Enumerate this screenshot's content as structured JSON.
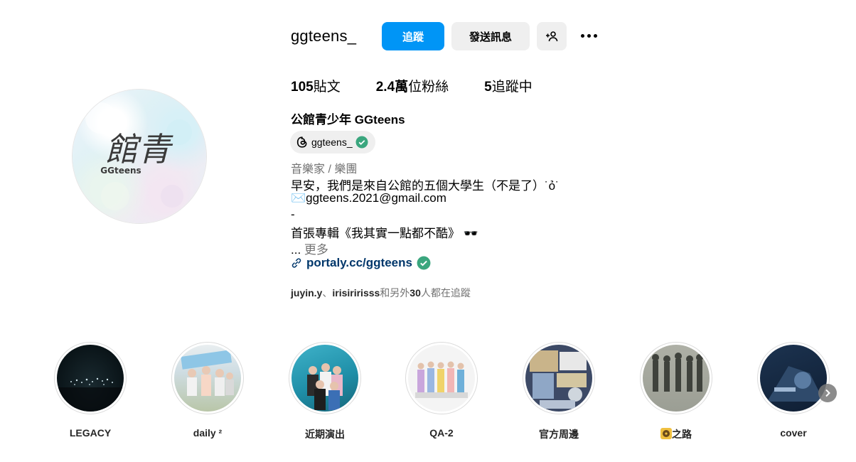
{
  "profile": {
    "username": "ggteens_",
    "follow_label": "追蹤",
    "message_label": "發送訊息",
    "avatar_text": "館青",
    "avatar_subtext": "GGteens",
    "stats": {
      "posts_count": "105",
      "posts_label": "貼文",
      "followers_count": "2.4萬",
      "followers_label": "位粉絲",
      "following_count": "5",
      "following_label": "追蹤中"
    },
    "full_name": "公館青少年 GGteens",
    "threads_handle": "ggteens_",
    "category": "音樂家 / 樂團",
    "bio_lines": [
      "早安，我們是來自公館的五個大學生（不是了）˙ỏ˙",
      "✉️ggteens.2021@gmail.com",
      "-",
      "首張專輯《我其實一點都不酷》 🕶️"
    ],
    "bio_ellipsis": "...",
    "more_label": "更多",
    "link": "portaly.cc/ggteens",
    "followed_by": {
      "user1": "juyin.y",
      "separator": "、",
      "user2": "irisiririsss",
      "text_before_count": "和另外",
      "count": "30",
      "text_after_count": "人都在追蹤"
    }
  },
  "highlights": [
    {
      "label": "LEGACY"
    },
    {
      "label": "daily ²"
    },
    {
      "label": "近期演出"
    },
    {
      "label": "QA-2"
    },
    {
      "label": "官方周邊"
    },
    {
      "label": "之路"
    },
    {
      "label": "cover"
    }
  ],
  "colors": {
    "accent": "#0095f6",
    "verified": "#3aa67e",
    "link": "#00376b",
    "secondary_text": "#737373",
    "button_gray": "#efefef"
  }
}
